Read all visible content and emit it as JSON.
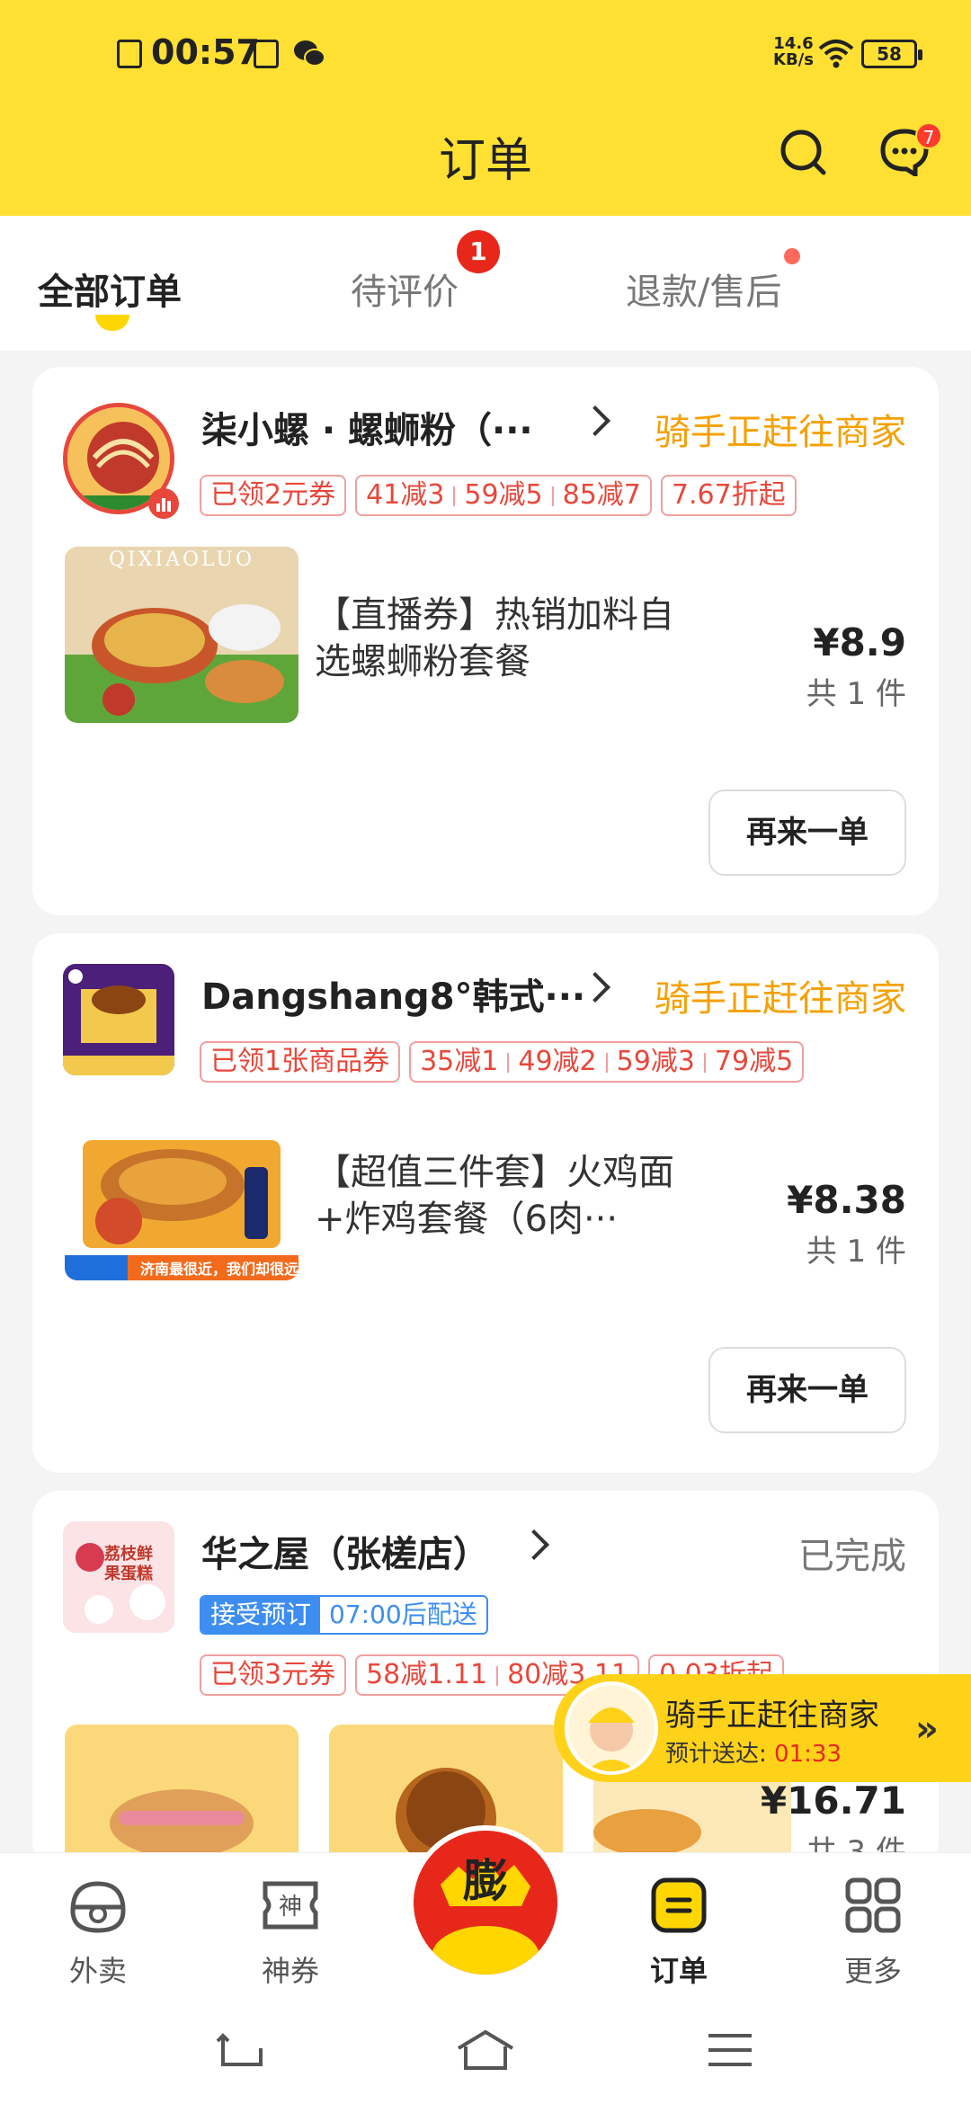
{
  "status_bar": {
    "time": "00:57",
    "speed_value": "14.6",
    "speed_unit": "KB/s",
    "battery": "58"
  },
  "header": {
    "title": "订单",
    "message_badge": "7"
  },
  "tabs": [
    {
      "label": "全部订单"
    },
    {
      "label": "待评价",
      "badge": "1"
    },
    {
      "label": "退款/售后"
    }
  ],
  "orders": [
    {
      "shop_name": "柒小螺 · 螺蛳粉（···",
      "status": "骑手正赶往商家",
      "coupon_tag": "已领2元券",
      "discounts": [
        "41减3",
        "59减5",
        "85减7"
      ],
      "discount_extra": "7.67折起",
      "item_name": "【直播券】热销加料自选螺蛳粉套餐",
      "image_text": "QIXIAOLUO",
      "price": "¥8.9",
      "count": "共 1 件",
      "reorder": "再来一单"
    },
    {
      "shop_name": "Dangshang8°韩式···",
      "status": "骑手正赶往商家",
      "coupon_tag": "已领1张商品券",
      "discounts": [
        "35减1",
        "49减2",
        "59减3",
        "79减5"
      ],
      "item_name": "【超值三件套】火鸡面+炸鸡套餐（6肉···",
      "image_text": "济南最很近，我们却很远",
      "price": "¥8.38",
      "count": "共 1 件",
      "reorder": "再来一单"
    },
    {
      "shop_name": "华之屋（张槎店）",
      "status": "已完成",
      "pre_tag_a": "接受预订",
      "pre_tag_b": "07:00后配送",
      "coupon_tag": "已领3元券",
      "discounts": [
        "58减1.11",
        "80减3.11"
      ],
      "discount_extra": "0.03折起",
      "price": "¥16.71",
      "count": "共 3 件",
      "logo_text": "荔枝鲜果蛋糕"
    }
  ],
  "rider_banner": {
    "title": "骑手正赶往商家",
    "eta_label": "预计送达:",
    "eta_time": "01:33"
  },
  "bottom_nav": [
    {
      "label": "外卖"
    },
    {
      "label": "神券"
    },
    {
      "label": "膨"
    },
    {
      "label": "订单"
    },
    {
      "label": "更多"
    }
  ],
  "colors": {
    "brand_yellow": "#ffe033",
    "status_orange": "#f5a000",
    "tag_red": "#e8473b",
    "badge_red": "#e8271b"
  }
}
